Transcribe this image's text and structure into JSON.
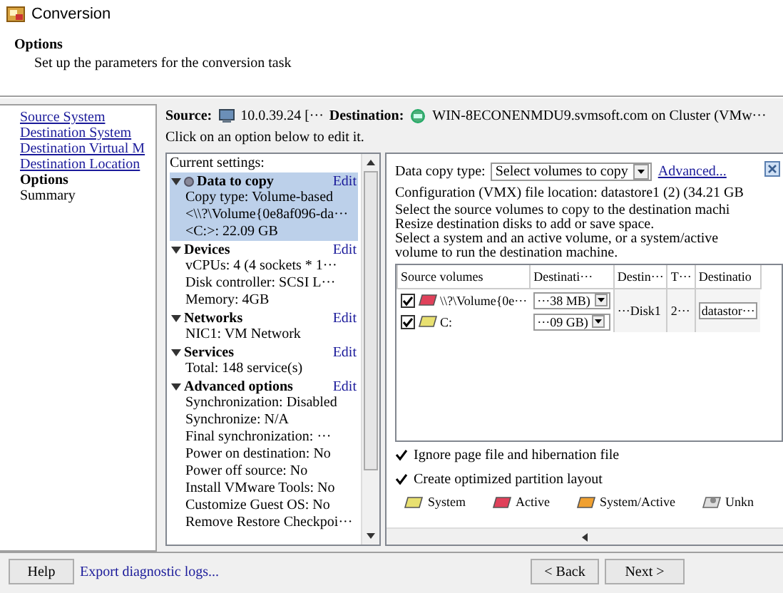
{
  "window": {
    "title": "Conversion"
  },
  "header": {
    "title": "Options",
    "subtitle": "Set up the parameters for the conversion task"
  },
  "nav": {
    "items": [
      {
        "label": "Source System",
        "kind": "link"
      },
      {
        "label": "Destination System",
        "kind": "link"
      },
      {
        "label": "Destination Virtual M",
        "kind": "link"
      },
      {
        "label": "Destination Location",
        "kind": "link"
      },
      {
        "label": "Options",
        "kind": "current"
      },
      {
        "label": "Summary",
        "kind": "pending"
      }
    ]
  },
  "summary_bar": {
    "source_label": "Source:",
    "source_value": "10.0.39.24 [···",
    "destination_label": "Destination:",
    "destination_value": "WIN-8ECONENMDU9.svmsoft.com on Cluster (VMw···",
    "hint": "Click on an option below to edit it."
  },
  "settings": {
    "title": "Current settings:",
    "sections": [
      {
        "title": "Data to copy",
        "edit": "Edit",
        "expanded": true,
        "selected": true,
        "lines": [
          "Copy type: Volume-based",
          "<\\\\?\\Volume{0e8af096-da···",
          "<C:>: 22.09 GB"
        ]
      },
      {
        "title": "Devices",
        "edit": "Edit",
        "expanded": true,
        "selected": false,
        "lines": [
          "vCPUs: 4 (4 sockets * 1···",
          "Disk controller: SCSI L···",
          "Memory: 4GB"
        ]
      },
      {
        "title": "Networks",
        "edit": "Edit",
        "expanded": true,
        "selected": false,
        "lines": [
          "NIC1: VM Network"
        ]
      },
      {
        "title": "Services",
        "edit": "Edit",
        "expanded": true,
        "selected": false,
        "lines": [
          "Total: 148 service(s)"
        ]
      },
      {
        "title": "Advanced options",
        "edit": "Edit",
        "expanded": true,
        "selected": false,
        "lines": [
          "Synchronization: Disabled",
          "Synchronize: N/A",
          "Final synchronization: ···",
          "Power on destination: No",
          "Power off source: No",
          "Install VMware Tools: No",
          "Customize Guest OS: No",
          "Remove Restore Checkpoi···"
        ]
      }
    ]
  },
  "data_copy": {
    "label": "Data copy type:",
    "dropdown": "Select volumes to copy",
    "advanced": "Advanced...",
    "config_line": "Configuration (VMX) file location: datastore1 (2) (34.21 GB",
    "instructions": [
      "Select the source volumes to copy to the destination machi",
      "Resize destination disks to add or save space.",
      "Select a system and an active volume, or a system/active",
      "volume to run the destination machine."
    ],
    "table": {
      "columns": [
        "Source volumes",
        "Destinati···",
        "Destin···",
        "T···",
        "Destinatio"
      ],
      "rows": [
        {
          "checked": true,
          "color": "#e0405a",
          "name": "\\\\?\\Volume{0e···",
          "size": "···38 MB)"
        },
        {
          "checked": true,
          "color": "#e8e070",
          "name": "C:",
          "size": "···09 GB)"
        }
      ],
      "disk": "···Disk1",
      "column_4": "2···",
      "datastore": "datastor···"
    },
    "options": [
      {
        "label": "Ignore page file and hibernation file",
        "checked": true
      },
      {
        "label": "Create optimized partition layout",
        "checked": true
      }
    ],
    "legend": [
      {
        "kind": "volume",
        "color": "#e8e070",
        "label": "System"
      },
      {
        "kind": "volume",
        "color": "#e0405a",
        "label": "Active"
      },
      {
        "kind": "volume",
        "color": "#f0a030",
        "label": "System/Active"
      },
      {
        "kind": "unknown",
        "label": "Unkn"
      }
    ]
  },
  "footer": {
    "help": "Help",
    "export": "Export diagnostic logs...",
    "back": "< Back",
    "next": "Next >"
  }
}
